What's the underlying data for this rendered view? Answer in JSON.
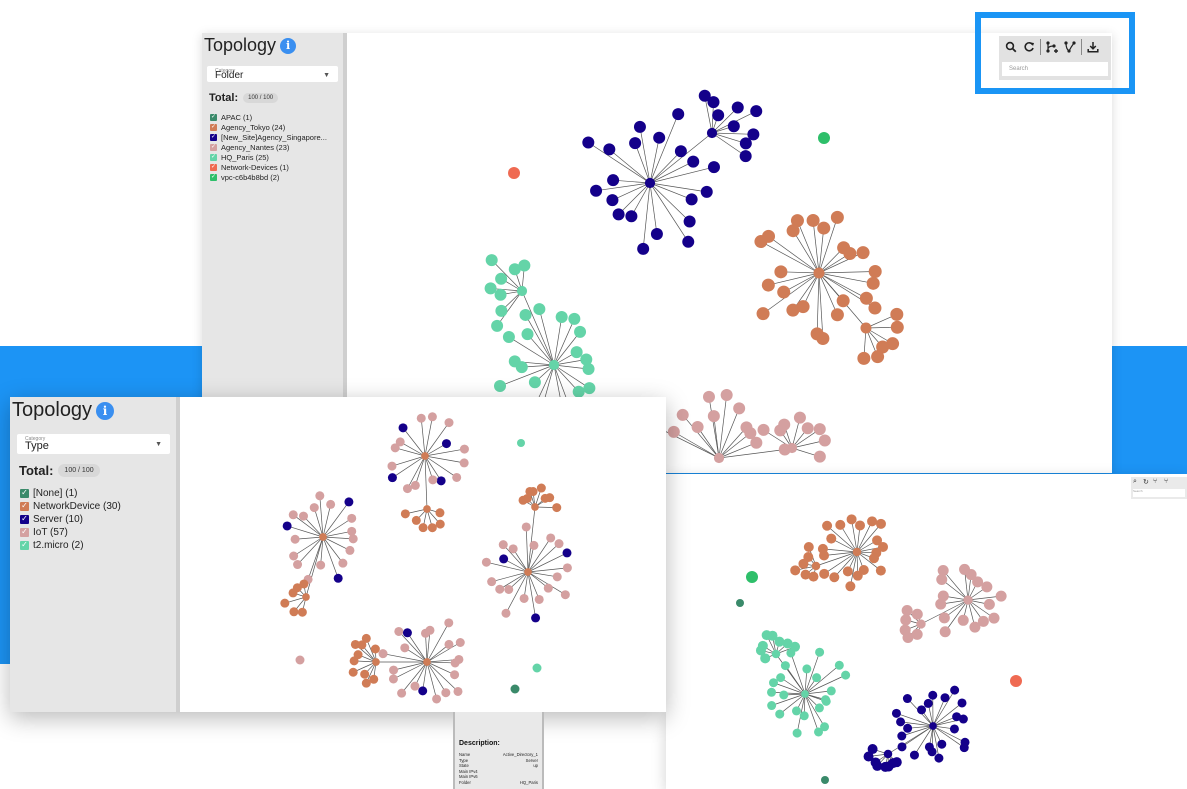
{
  "colors": {
    "blue_band": "#1c94f5",
    "highlight": "#1a95f5",
    "navy": "#14008a",
    "terracotta": "#d07c56",
    "rose": "#d4a0a0",
    "teal": "#64d4a8",
    "dark_teal": "#3a8a6a",
    "green": "#2ebf6a",
    "coral": "#ef6a52"
  },
  "back_panel": {
    "title": "Topology",
    "category_label": "Category",
    "category_value": "Folder",
    "total_label": "Total:",
    "total_value": "100 / 100",
    "legend": [
      {
        "label": "APAC (1)",
        "color": "#3a8a6a"
      },
      {
        "label": "Agency_Tokyo (24)",
        "color": "#d07c56"
      },
      {
        "label": "[New_Site]Agency_Singapore...",
        "color": "#14008a"
      },
      {
        "label": "Agency_Nantes (23)",
        "color": "#d4a0a0"
      },
      {
        "label": "HQ_Paris (25)",
        "color": "#64d4a8"
      },
      {
        "label": "Network-Devices (1)",
        "color": "#ef6a52"
      },
      {
        "label": "vpc-c6b4b8bd (2)",
        "color": "#2ebf6a"
      }
    ]
  },
  "front_panel": {
    "title": "Topology",
    "category_label": "Category",
    "category_value": "Type",
    "total_label": "Total:",
    "total_value": "100 / 100",
    "legend": [
      {
        "label": "[None] (1)",
        "color": "#3a8a6a"
      },
      {
        "label": "NetworkDevice (30)",
        "color": "#d07c56"
      },
      {
        "label": "Server (10)",
        "color": "#14008a"
      },
      {
        "label": "IoT (57)",
        "color": "#d4a0a0"
      },
      {
        "label": "t2.micro (2)",
        "color": "#64d4a8"
      }
    ]
  },
  "toolbar": {
    "icons": [
      "search-icon",
      "refresh-icon",
      "add-edge-icon",
      "edge-icon",
      "download-icon"
    ],
    "search_placeholder": "Search"
  },
  "mini_toolbar": {
    "search_placeholder": "Search"
  },
  "description": {
    "title": "Description:",
    "rows": [
      {
        "key": "Name",
        "value": "Active_Directory_1"
      },
      {
        "key": "Type",
        "value": "Server"
      },
      {
        "key": "State",
        "value": "up"
      },
      {
        "key": "Main IPv4",
        "value": ""
      },
      {
        "key": "Main IPv6",
        "value": ""
      },
      {
        "key": "Folder",
        "value": "HQ_Paris"
      }
    ]
  }
}
